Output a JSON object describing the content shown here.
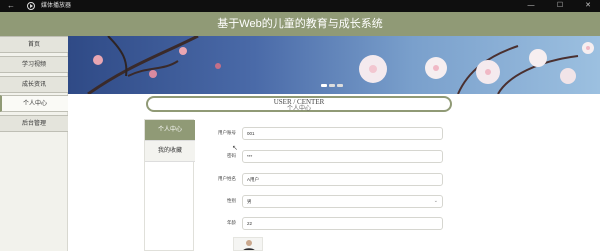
{
  "window": {
    "back_glyph": "←",
    "app_title": "媒体播放器",
    "minimize": "—",
    "maximize": "☐",
    "close": "✕"
  },
  "header": {
    "title": "基于Web的儿童的教育与成长系统"
  },
  "sidebar": {
    "items": [
      {
        "label": "首页"
      },
      {
        "label": "学习视频"
      },
      {
        "label": "成长资讯"
      },
      {
        "label": "个人中心"
      },
      {
        "label": "后台管理"
      }
    ]
  },
  "section": {
    "title_en": "USER / CENTER",
    "title_cn": "个人中心"
  },
  "tabs": [
    {
      "label": "个人中心"
    },
    {
      "label": "我的收藏"
    }
  ],
  "form": {
    "fields": [
      {
        "label": "用户账号",
        "value": "001"
      },
      {
        "label": "密码",
        "value": "***"
      },
      {
        "label": "用户姓名",
        "value": "A用户"
      },
      {
        "label": "性别",
        "value": "男"
      },
      {
        "label": "年龄",
        "value": "22"
      }
    ]
  },
  "colors": {
    "accent": "#909a76"
  }
}
